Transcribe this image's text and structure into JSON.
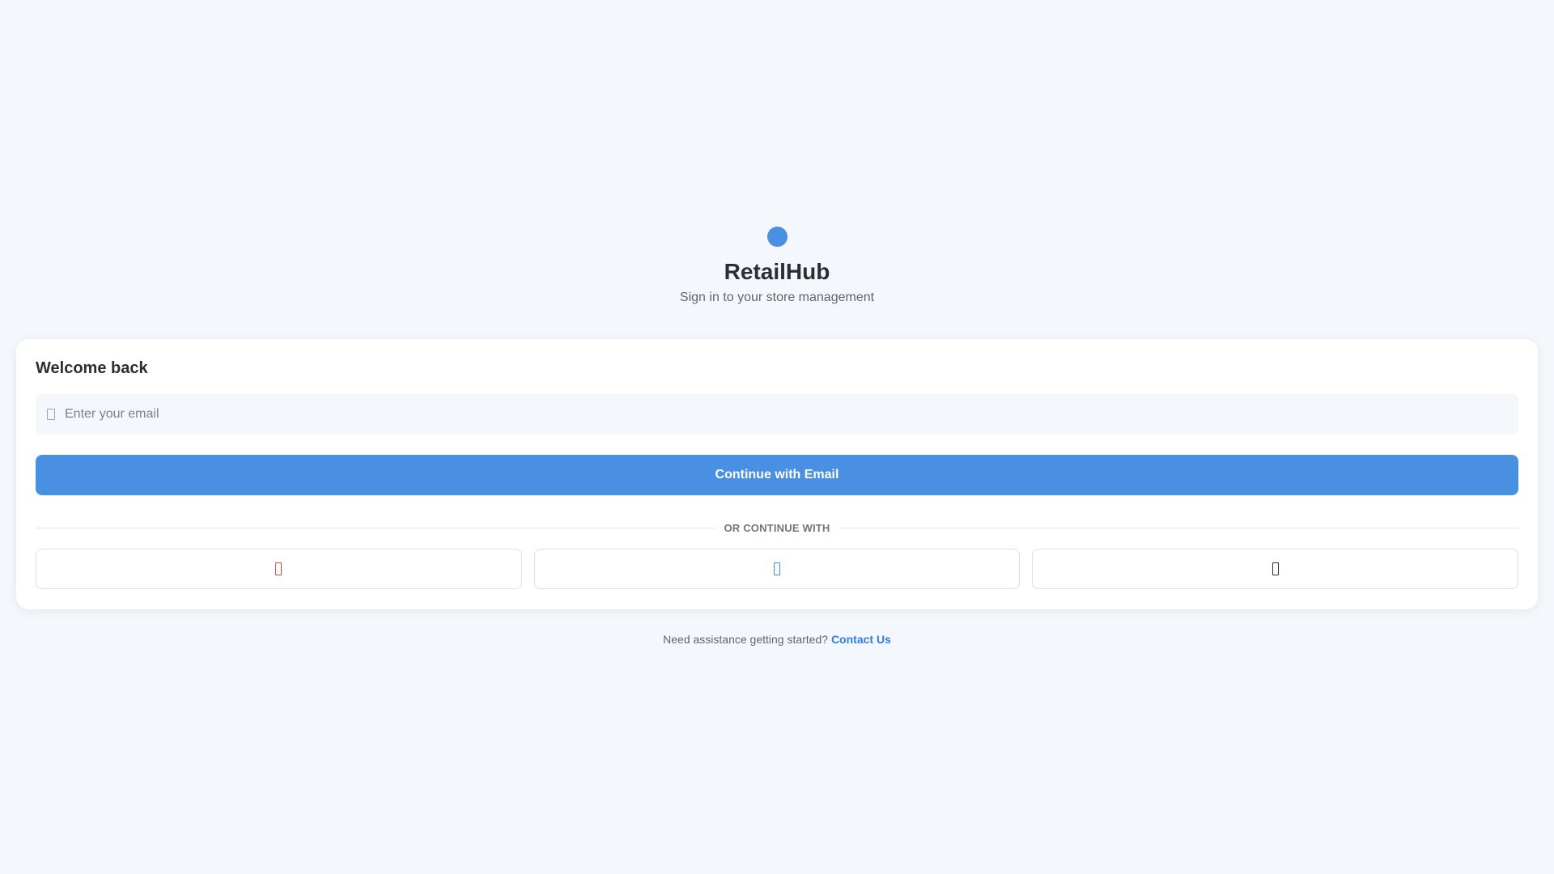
{
  "brand": {
    "title": "RetailHub",
    "subtitle": "Sign in to your store management",
    "logo_color": "#4a90e2"
  },
  "card": {
    "heading": "Welcome back",
    "email": {
      "placeholder": "Enter your email",
      "value": "",
      "icon": "mail-icon"
    },
    "continue_label": "Continue with Email",
    "divider_label": "OR CONTINUE WITH",
    "social": [
      {
        "icon": "google-icon",
        "color": "#e5453a"
      },
      {
        "icon": "microsoft-icon",
        "color": "#2f8fe0"
      },
      {
        "icon": "apple-icon",
        "color": "#2b2f33"
      }
    ]
  },
  "footer": {
    "prompt": "Need assistance getting started?",
    "link_label": "Contact Us"
  },
  "colors": {
    "accent": "#4a90e2",
    "background": "#f4f7fb",
    "link": "#2f7fd8"
  }
}
